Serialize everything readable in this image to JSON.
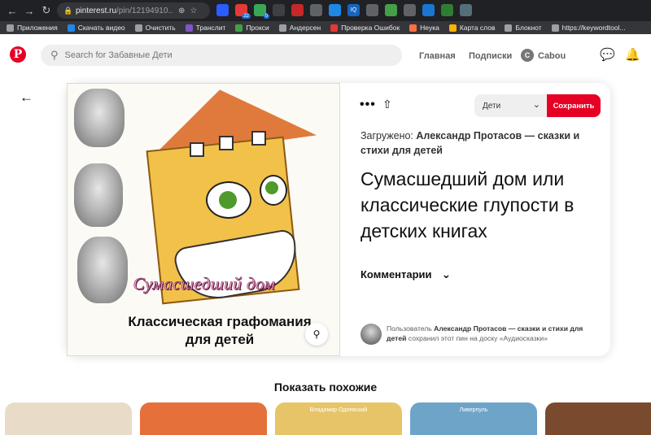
{
  "browser": {
    "url_host": "pinterest.ru",
    "url_path": "/pin/12194910...",
    "extensions": [
      {
        "icon": "flag-fr-icon",
        "color": "#2a5cff"
      },
      {
        "icon": "ext-22-icon",
        "color": "#e53935",
        "badge": "22"
      },
      {
        "icon": "ext-0-icon",
        "color": "#3aa757",
        "badge": "0"
      },
      {
        "icon": "ext-x-icon",
        "color": "#3c4043"
      },
      {
        "icon": "ext-red-icon",
        "color": "#c62828"
      },
      {
        "icon": "ext-chat-icon",
        "color": "#5f6368"
      },
      {
        "icon": "ext-globe-icon",
        "color": "#1e88e5"
      },
      {
        "icon": "ext-iq-icon",
        "color": "#1565c0",
        "text": "IQ"
      },
      {
        "icon": "ext-down-icon",
        "color": "#5f6368"
      },
      {
        "icon": "ext-puzzle-icon",
        "color": "#43a047"
      },
      {
        "icon": "ext-shield-icon",
        "color": "#5f6368"
      },
      {
        "icon": "ext-blue-icon",
        "color": "#1976d2"
      },
      {
        "icon": "ext-check-icon",
        "color": "#2e7d32"
      },
      {
        "icon": "ext-grid-icon",
        "color": "#546e7a"
      }
    ],
    "bookmarks": [
      {
        "label": "Приложения",
        "icon": "apps-grid-icon",
        "color": "#9aa0a6"
      },
      {
        "label": "Скачать видео",
        "icon": "download-video-icon",
        "color": "#1e88e5"
      },
      {
        "label": "Очистить",
        "icon": "broom-icon",
        "color": "#9aa0a6"
      },
      {
        "label": "Транслит",
        "icon": "translit-icon",
        "color": "#7e57c2"
      },
      {
        "label": "Прокси",
        "icon": "shield-icon",
        "color": "#43a047"
      },
      {
        "label": "Андерсен",
        "icon": "globe-icon",
        "color": "#9aa0a6"
      },
      {
        "label": "Проверка Ошибок",
        "icon": "check-errors-icon",
        "color": "#e53935"
      },
      {
        "label": "Неука",
        "icon": "neuka-icon",
        "color": "#ff7043"
      },
      {
        "label": "Карта слов",
        "icon": "word-map-icon",
        "color": "#ffb300"
      },
      {
        "label": "Блокнот",
        "icon": "notepad-icon",
        "color": "#9aa0a6"
      },
      {
        "label": "https://keywordtool...",
        "icon": "globe-icon",
        "color": "#9aa0a6"
      }
    ]
  },
  "header": {
    "search_placeholder": "Search for Забавные Дети",
    "nav_home": "Главная",
    "nav_following": "Подписки",
    "avatar_letter": "C",
    "username": "Cabou"
  },
  "pin": {
    "image_title": "Сумасшедший дом",
    "image_subtitle_line1": "Классическая графомания",
    "image_subtitle_line2": "для детей",
    "board_select": "Дети",
    "save_label": "Сохранить",
    "uploaded_prefix": "Загружено:",
    "uploaded_by": "Александр Протасов — сказки и стихи для детей",
    "title": "Сумасшедший дом или классические глупости в детских книгах",
    "comments_label": "Комментарии",
    "saver_prefix": "Пользователь",
    "saver_name": "Александр Протасов — сказки и стихи для детей",
    "saver_suffix": "сохранил этот пин на доску «Аудиосказки»"
  },
  "more_like_this": "Показать похожие",
  "thumbs": [
    {
      "color": "#e8dcc9",
      "caption": ""
    },
    {
      "color": "#e5703a",
      "caption": ""
    },
    {
      "color": "#e8c468",
      "caption": "Владимир Одоевский"
    },
    {
      "color": "#6fa4c9",
      "caption": "Ливерпуль"
    },
    {
      "color": "#7a4a2e",
      "caption": ""
    }
  ],
  "colors": {
    "brand_red": "#e60023",
    "chrome_dark": "#202124",
    "bookmarks_bg": "#35363a"
  }
}
